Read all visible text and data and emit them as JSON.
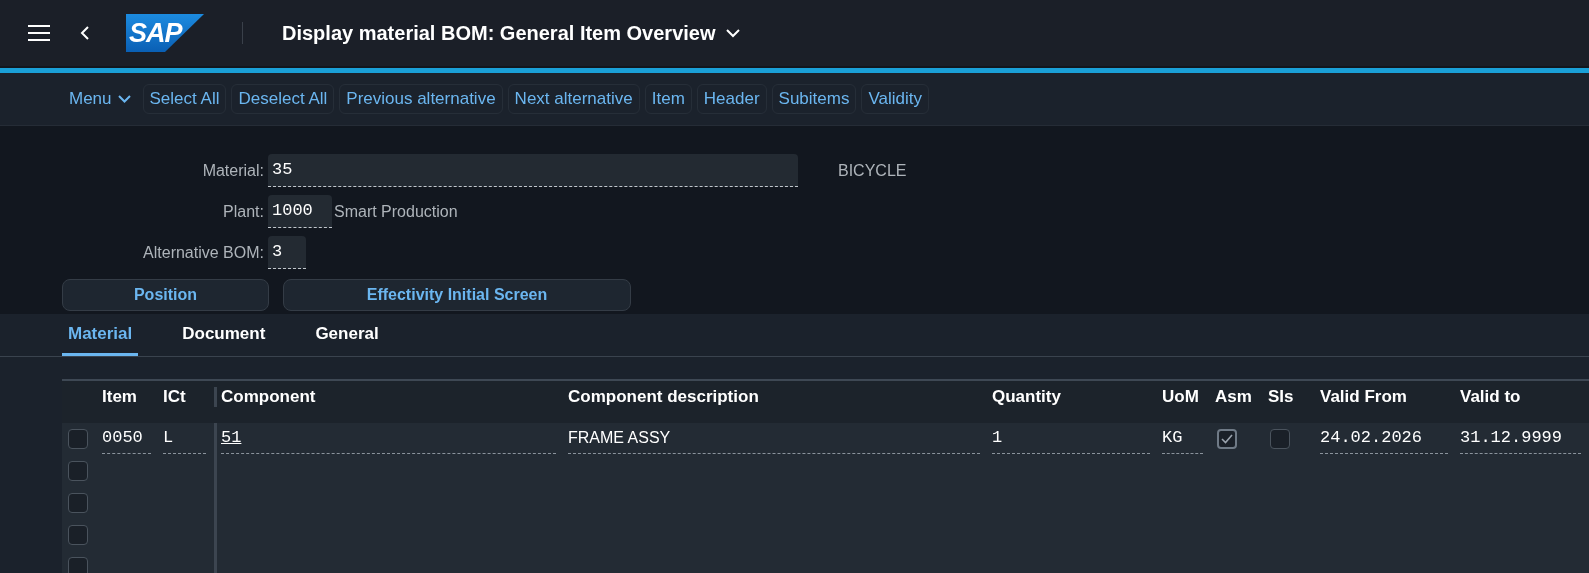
{
  "shell": {
    "logo": "SAP",
    "title": "Display material BOM: General Item Overview"
  },
  "toolbar": {
    "menu": "Menu",
    "buttons": [
      "Select All",
      "Deselect All",
      "Previous alternative",
      "Next alternative",
      "Item",
      "Header",
      "Subitems",
      "Validity"
    ]
  },
  "form": {
    "fields": [
      {
        "label": "Material:",
        "value": "35",
        "description": "BICYCLE",
        "kind": "wide"
      },
      {
        "label": "Plant:",
        "value": "1000",
        "description": "Smart Production",
        "kind": "short"
      },
      {
        "label": "Alternative BOM:",
        "value": "3",
        "kind": "tiny"
      }
    ],
    "buttons": [
      "Position",
      "Effectivity Initial Screen"
    ]
  },
  "tabs": [
    {
      "label": "Material",
      "selected": true
    },
    {
      "label": "Document",
      "selected": false
    },
    {
      "label": "General",
      "selected": false
    }
  ],
  "table": {
    "columns": [
      "Item",
      "ICt",
      "Component",
      "Component description",
      "Quantity",
      "UoM",
      "Asm",
      "SIs",
      "Valid From",
      "Valid to"
    ],
    "rows": [
      {
        "selected": false,
        "item": "0050",
        "ict": "L",
        "component": "51",
        "description": "FRAME ASSY",
        "quantity": "1",
        "uom": "KG",
        "asm": true,
        "sis": false,
        "valid_from": "24.02.2026",
        "valid_to": "31.12.9999"
      },
      {
        "selected": false
      },
      {
        "selected": false
      },
      {
        "selected": false
      },
      {
        "selected": false
      }
    ]
  }
}
